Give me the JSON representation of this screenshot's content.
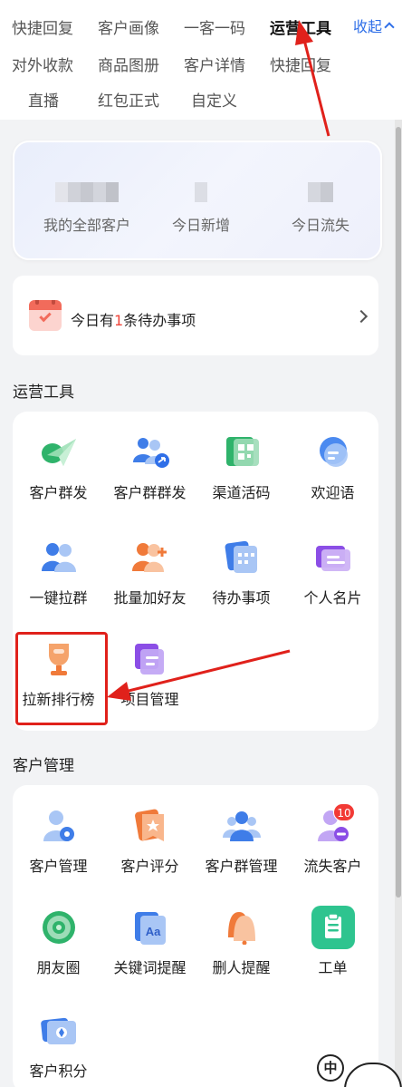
{
  "tabs": [
    {
      "label": "快捷回复",
      "active": false
    },
    {
      "label": "客户画像",
      "active": false
    },
    {
      "label": "一客一码",
      "active": false
    },
    {
      "label": "运营工具",
      "active": true
    },
    {
      "label": "对外收款",
      "active": false
    },
    {
      "label": "商品图册",
      "active": false
    },
    {
      "label": "客户详情",
      "active": false
    },
    {
      "label": "快捷回复",
      "active": false
    },
    {
      "label": "直播",
      "active": false
    },
    {
      "label": "红包正式",
      "active": false
    },
    {
      "label": "自定义",
      "active": false
    }
  ],
  "collapse_label": "收起",
  "stats": [
    {
      "label": "我的全部客户"
    },
    {
      "label": "今日新增"
    },
    {
      "label": "今日流失"
    }
  ],
  "todo": {
    "prefix": "今日有",
    "count": "1",
    "suffix": "条待办事项"
  },
  "sections": {
    "ops_title": "运营工具",
    "customer_title": "客户管理"
  },
  "ops_tools": [
    {
      "label": "客户群发",
      "icon": "paper-plane-icon"
    },
    {
      "label": "客户群群发",
      "icon": "group-send-icon"
    },
    {
      "label": "渠道活码",
      "icon": "qr-code-icon"
    },
    {
      "label": "欢迎语",
      "icon": "chat-bubble-icon"
    },
    {
      "label": "一键拉群",
      "icon": "group-icon"
    },
    {
      "label": "批量加好友",
      "icon": "add-friends-icon"
    },
    {
      "label": "待办事项",
      "icon": "calendar-icon"
    },
    {
      "label": "个人名片",
      "icon": "card-icon"
    },
    {
      "label": "拉新排行榜",
      "icon": "trophy-icon"
    },
    {
      "label": "项目管理",
      "icon": "project-icon"
    }
  ],
  "customer_tools": [
    {
      "label": "客户管理",
      "icon": "customer-settings-icon"
    },
    {
      "label": "客户评分",
      "icon": "rating-icon"
    },
    {
      "label": "客户群管理",
      "icon": "group-manage-icon"
    },
    {
      "label": "流失客户",
      "icon": "lost-customer-icon",
      "badge": "10"
    },
    {
      "label": "朋友圈",
      "icon": "moments-icon"
    },
    {
      "label": "关键词提醒",
      "icon": "keyword-icon"
    },
    {
      "label": "删人提醒",
      "icon": "bell-icon"
    },
    {
      "label": "工单",
      "icon": "ticket-icon"
    },
    {
      "label": "客户积分",
      "icon": "points-icon"
    }
  ],
  "floating": {
    "bubble_text": "中"
  },
  "colors": {
    "accent": "#2f6fe8",
    "annotation_red": "#e0211b",
    "badge_red": "#f23a35"
  }
}
